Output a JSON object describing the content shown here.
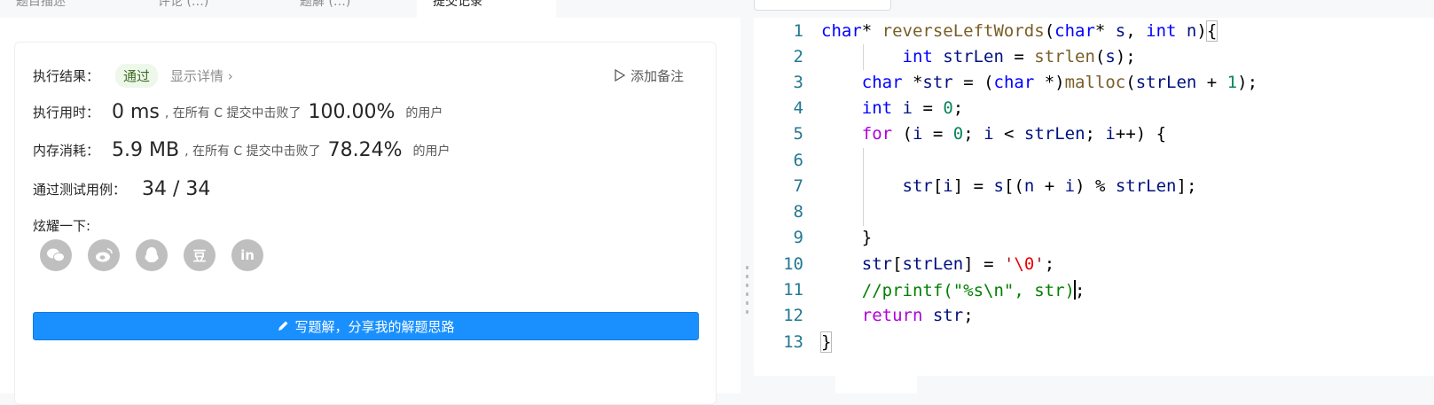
{
  "tabs": [
    {
      "label": "题目描述"
    },
    {
      "label": "评论 (…)"
    },
    {
      "label": "题解 (…)"
    },
    {
      "label": "提交记录"
    }
  ],
  "result": {
    "label": "执行结果：",
    "status": "通过",
    "details_link": "显示详情 ›",
    "add_note": "添加备注"
  },
  "runtime": {
    "label": "执行用时：",
    "value": "0 ms",
    "beat_text": ", 在所有 C 提交中击败了",
    "percent": "100.00%",
    "users": "的用户"
  },
  "memory": {
    "label": "内存消耗：",
    "value": "5.9 MB",
    "beat_text": ", 在所有 C 提交中击败了",
    "percent": "78.24%",
    "users": "的用户"
  },
  "tests": {
    "label": "通过测试用例：",
    "value": "34 / 34"
  },
  "share": {
    "label": "炫耀一下:",
    "icons": [
      "wechat-icon",
      "weibo-icon",
      "qq-icon",
      "douban-icon",
      "linkedin-icon"
    ],
    "douban_glyph": "豆",
    "linkedin_glyph": "in"
  },
  "write_solution": "写题解，分享我的解题思路",
  "editor": {
    "line_numbers": [
      "1",
      "2",
      "3",
      "4",
      "5",
      "6",
      "7",
      "8",
      "9",
      "10",
      "11",
      "12",
      "13"
    ],
    "line_5_keyword": "for"
  }
}
